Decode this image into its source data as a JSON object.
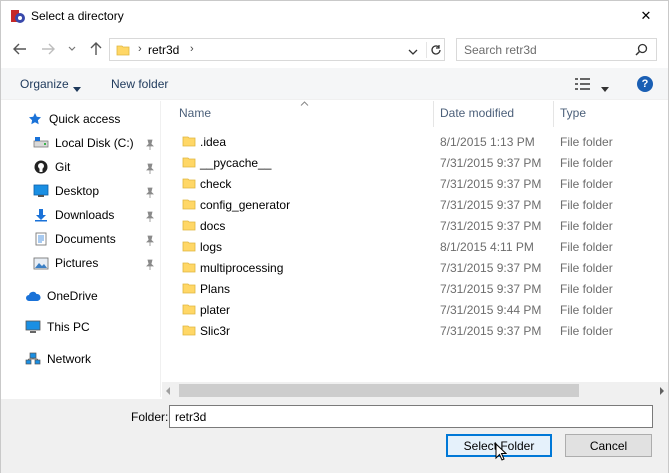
{
  "window": {
    "title": "Select a directory",
    "close_glyph": "✕"
  },
  "address": {
    "crumbs": [
      "retr3d"
    ],
    "separator": "›"
  },
  "search": {
    "placeholder": "Search retr3d"
  },
  "toolbar": {
    "organize_label": "Organize",
    "new_folder_label": "New folder",
    "help_label": "?"
  },
  "nav_pane": {
    "quick_access": "Quick access",
    "items": [
      {
        "label": "Local Disk (C:)",
        "icon": "drive-icon",
        "pinned": true
      },
      {
        "label": "Git",
        "icon": "github-icon",
        "pinned": true
      },
      {
        "label": "Desktop",
        "icon": "desktop-icon",
        "pinned": true
      },
      {
        "label": "Downloads",
        "icon": "downloads-icon",
        "pinned": true
      },
      {
        "label": "Documents",
        "icon": "documents-icon",
        "pinned": true
      },
      {
        "label": "Pictures",
        "icon": "pictures-icon",
        "pinned": true
      }
    ],
    "onedrive": "OneDrive",
    "this_pc": "This PC",
    "network": "Network"
  },
  "file_list": {
    "columns": {
      "name": "Name",
      "date": "Date modified",
      "type": "Type"
    },
    "rows": [
      {
        "name": ".idea",
        "date": "8/1/2015 1:13 PM",
        "type": "File folder"
      },
      {
        "name": "__pycache__",
        "date": "7/31/2015 9:37 PM",
        "type": "File folder"
      },
      {
        "name": "check",
        "date": "7/31/2015 9:37 PM",
        "type": "File folder"
      },
      {
        "name": "config_generator",
        "date": "7/31/2015 9:37 PM",
        "type": "File folder"
      },
      {
        "name": "docs",
        "date": "7/31/2015 9:37 PM",
        "type": "File folder"
      },
      {
        "name": "logs",
        "date": "8/1/2015 4:11 PM",
        "type": "File folder"
      },
      {
        "name": "multiprocessing",
        "date": "7/31/2015 9:37 PM",
        "type": "File folder"
      },
      {
        "name": "Plans",
        "date": "7/31/2015 9:37 PM",
        "type": "File folder"
      },
      {
        "name": "plater",
        "date": "7/31/2015 9:44 PM",
        "type": "File folder"
      },
      {
        "name": "Slic3r",
        "date": "7/31/2015 9:37 PM",
        "type": "File folder"
      }
    ]
  },
  "bottom": {
    "folder_label": "Folder:",
    "folder_value": "retr3d",
    "select_label": "Select Folder",
    "cancel_label": "Cancel"
  },
  "colors": {
    "accent": "#0078d7",
    "folder": "#ffd766",
    "quick_access_star": "#1a72d8"
  }
}
